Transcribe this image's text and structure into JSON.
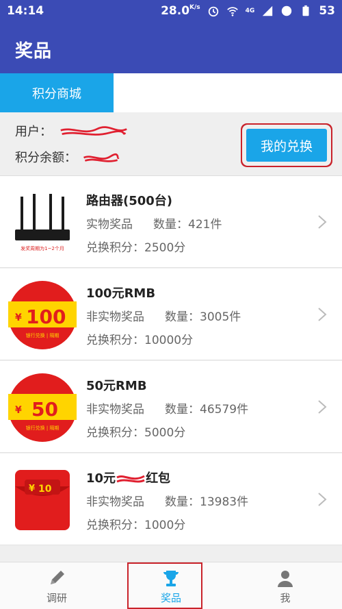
{
  "status": {
    "time": "14:14",
    "speed": "28.0",
    "speed_unit": "K/s",
    "network": "4G",
    "battery": "53"
  },
  "appbar": {
    "title": "奖品"
  },
  "tabs": [
    {
      "label": "积分商城"
    }
  ],
  "user": {
    "user_label": "用户：",
    "balance_label": "积分余额：",
    "exchange_button": "我的兑换"
  },
  "items": [
    {
      "name": "路由器(500台)",
      "type": "实物奖品",
      "qty_label": "数量：421件",
      "points": "兑换积分：2500分",
      "thumb_text": "发奖周期为1~2个月"
    },
    {
      "name": "100元RMB",
      "type": "非实物奖品",
      "qty_label": "数量：3005件",
      "points": "兑换积分：10000分",
      "badge": "100",
      "badge_sub": "银行兑换 | 隔期"
    },
    {
      "name": "50元RMB",
      "type": "非实物奖品",
      "qty_label": "数量：46579件",
      "points": "兑换积分：5000分",
      "badge": "50",
      "badge_sub": "银行兑换 | 隔期"
    },
    {
      "name": "10元",
      "name_tail": "红包",
      "type": "非实物奖品",
      "qty_label": "数量：13983件",
      "points": "兑换积分：1000分",
      "badge": "10"
    }
  ],
  "nav": [
    {
      "label": "调研",
      "icon": "pencil-icon"
    },
    {
      "label": "奖品",
      "icon": "trophy-icon"
    },
    {
      "label": "我",
      "icon": "user-icon"
    }
  ],
  "colors": {
    "primary": "#3b4bb5",
    "accent": "#1aa5e8",
    "highlight": "#c9222a"
  }
}
